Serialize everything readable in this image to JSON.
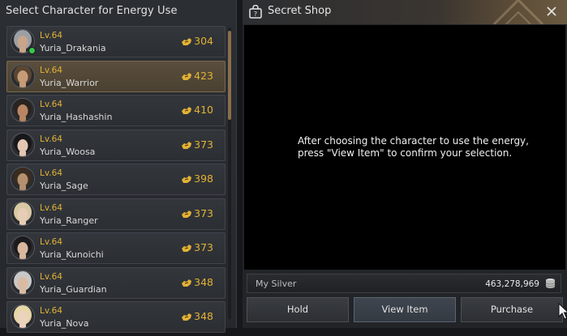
{
  "left_panel": {
    "title": "Select Character for Energy Use",
    "characters": [
      {
        "level": "Lv.64",
        "name": "Yuria_Drakania",
        "energy": "304",
        "online": true,
        "selected": false,
        "hair": "#9aa0a6",
        "skin": "#c9a58a"
      },
      {
        "level": "Lv.64",
        "name": "Yuria_Warrior",
        "energy": "423",
        "online": false,
        "selected": true,
        "hair": "#5a4632",
        "skin": "#c69c78"
      },
      {
        "level": "Lv.64",
        "name": "Yuria_Hashashin",
        "energy": "410",
        "online": false,
        "selected": false,
        "hair": "#2a2420",
        "skin": "#b88664"
      },
      {
        "level": "Lv.64",
        "name": "Yuria_Woosa",
        "energy": "373",
        "online": false,
        "selected": false,
        "hair": "#18171a",
        "skin": "#e3c7b2"
      },
      {
        "level": "Lv.64",
        "name": "Yuria_Sage",
        "energy": "398",
        "online": false,
        "selected": false,
        "hair": "#3a2c20",
        "skin": "#b4906e"
      },
      {
        "level": "Lv.64",
        "name": "Yuria_Ranger",
        "energy": "373",
        "online": false,
        "selected": false,
        "hair": "#d8c9a4",
        "skin": "#e7cdb6"
      },
      {
        "level": "Lv.64",
        "name": "Yuria_Kunoichi",
        "energy": "373",
        "online": false,
        "selected": false,
        "hair": "#1c1a1c",
        "skin": "#d8b79e"
      },
      {
        "level": "Lv.64",
        "name": "Yuria_Guardian",
        "energy": "348",
        "online": false,
        "selected": false,
        "hair": "#c8c8c8",
        "skin": "#d9bba4"
      },
      {
        "level": "Lv.64",
        "name": "Yuria_Nova",
        "energy": "348",
        "online": false,
        "selected": false,
        "hair": "#e6d6a8",
        "skin": "#ecd3bd"
      }
    ]
  },
  "shop": {
    "title": "Secret Shop",
    "message_line1": "After choosing the character to use the energy,",
    "message_line2": "press \"View Item\" to confirm your selection.",
    "silver_label": "My Silver",
    "silver_value": "463,278,969",
    "buttons": {
      "hold": "Hold",
      "view_item": "View Item",
      "purchase": "Purchase"
    }
  },
  "colors": {
    "level_gold": "#e3b235",
    "energy_gold": "#e3b235",
    "selected_row": "#5a4e3c",
    "online_green": "#34c84a"
  },
  "icons": {
    "energy": "energy-hand-icon",
    "shop": "shop-bag-icon",
    "close": "close-icon",
    "silver": "silver-coin-stack-icon",
    "cursor": "mouse-cursor-icon"
  }
}
